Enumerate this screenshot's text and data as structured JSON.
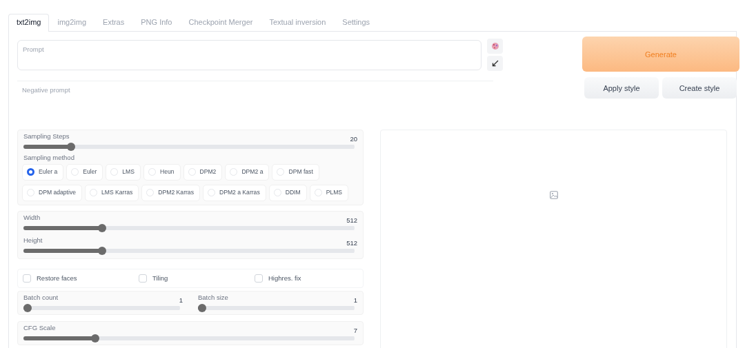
{
  "tabs": [
    {
      "label": "txt2img",
      "selected": true
    },
    {
      "label": "img2img",
      "selected": false
    },
    {
      "label": "Extras",
      "selected": false
    },
    {
      "label": "PNG Info",
      "selected": false
    },
    {
      "label": "Checkpoint Merger",
      "selected": false
    },
    {
      "label": "Textual inversion",
      "selected": false
    },
    {
      "label": "Settings",
      "selected": false
    }
  ],
  "prompt": {
    "placeholder": "Prompt"
  },
  "negative_prompt": {
    "placeholder": "Negative prompt"
  },
  "generate_button": "Generate",
  "style_buttons": [
    "Apply style",
    "Create style"
  ],
  "sampling_steps": {
    "label": "Sampling Steps",
    "value": "20",
    "level": 0.135
  },
  "sampling_method": {
    "label": "Sampling method",
    "options": [
      {
        "label": "Euler a",
        "selected": true
      },
      {
        "label": "Euler",
        "selected": false
      },
      {
        "label": "LMS",
        "selected": false
      },
      {
        "label": "Heun",
        "selected": false
      },
      {
        "label": "DPM2",
        "selected": false
      },
      {
        "label": "DPM2 a",
        "selected": false
      },
      {
        "label": "DPM fast",
        "selected": false
      },
      {
        "label": "DPM adaptive",
        "selected": false
      },
      {
        "label": "LMS Karras",
        "selected": false
      },
      {
        "label": "DPM2 Karras",
        "selected": false
      },
      {
        "label": "DPM2 a Karras",
        "selected": false
      },
      {
        "label": "DDIM",
        "selected": false
      },
      {
        "label": "PLMS",
        "selected": false
      }
    ]
  },
  "size": [
    {
      "label": "Width",
      "value": "512",
      "level": 0.23
    },
    {
      "label": "Height",
      "value": "512",
      "level": 0.23
    }
  ],
  "options": [
    {
      "label": "Restore faces",
      "checked": false
    },
    {
      "label": "Tiling",
      "checked": false
    },
    {
      "label": "Highres. fix",
      "checked": false
    }
  ],
  "batch": [
    {
      "label": "Batch count",
      "value": "1",
      "level": 0
    },
    {
      "label": "Batch size",
      "value": "1",
      "level": 0
    }
  ],
  "cfg_scale": {
    "label": "CFG Scale",
    "value": "7",
    "level": 0.21
  }
}
